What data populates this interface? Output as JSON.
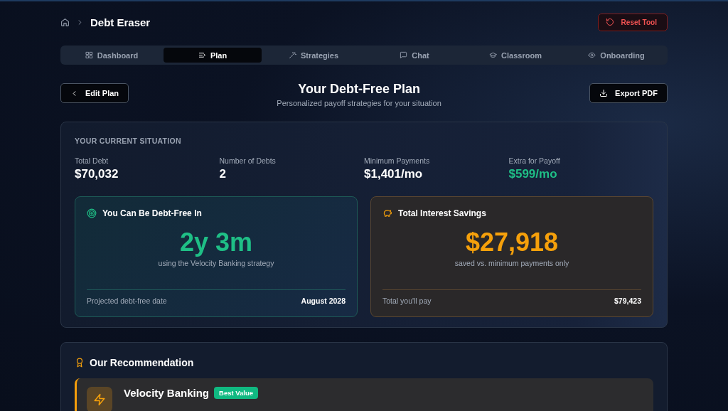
{
  "breadcrumb": {
    "title": "Debt Eraser"
  },
  "reset_button": "Reset Tool",
  "tabs": [
    {
      "label": "Dashboard",
      "selected": false
    },
    {
      "label": "Plan",
      "selected": true
    },
    {
      "label": "Strategies",
      "selected": false
    },
    {
      "label": "Chat",
      "selected": false
    },
    {
      "label": "Classroom",
      "selected": false
    },
    {
      "label": "Onboarding",
      "selected": false
    }
  ],
  "header": {
    "back_button": "Edit Plan",
    "title": "Your Debt-Free Plan",
    "subtitle": "Personalized payoff strategies for your situation",
    "export_button": "Export PDF"
  },
  "situation": {
    "heading": "YOUR CURRENT SITUATION",
    "stats": [
      {
        "label": "Total Debt",
        "value": "$70,032",
        "highlight": false
      },
      {
        "label": "Number of Debts",
        "value": "2",
        "highlight": false
      },
      {
        "label": "Minimum Payments",
        "value": "$1,401/mo",
        "highlight": false
      },
      {
        "label": "Extra for Payoff",
        "value": "$599/mo",
        "highlight": true
      }
    ],
    "cards": [
      {
        "kind": "time",
        "title": "You Can Be Debt-Free In",
        "big": "2y 3m",
        "caption": "using the Velocity Banking strategy",
        "foot_label": "Projected debt-free date",
        "foot_value": "August 2028"
      },
      {
        "kind": "savings",
        "title": "Total Interest Savings",
        "big": "$27,918",
        "caption": "saved vs. minimum payments only",
        "foot_label": "Total you'll pay",
        "foot_value": "$79,423"
      }
    ]
  },
  "recommendation": {
    "heading": "Our Recommendation",
    "name": "Velocity Banking",
    "badge": "Best Value"
  }
}
